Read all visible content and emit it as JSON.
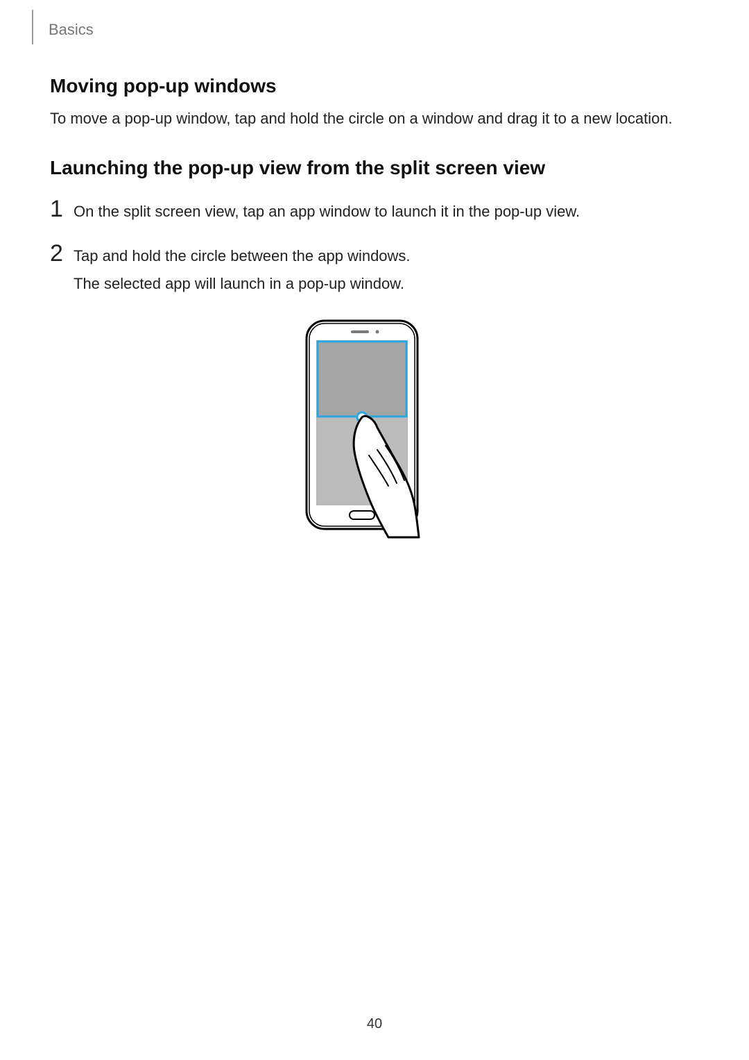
{
  "header": {
    "section": "Basics"
  },
  "sections": {
    "moving": {
      "title": "Moving pop-up windows",
      "body": "To move a pop-up window, tap and hold the circle on a window and drag it to a new location."
    },
    "launching": {
      "title": "Launching the pop-up view from the split screen view",
      "steps": [
        {
          "num": "1",
          "line1": "On the split screen view, tap an app window to launch it in the pop-up view."
        },
        {
          "num": "2",
          "line1": "Tap and hold the circle between the app windows.",
          "line2": "The selected app will launch in a pop-up window."
        }
      ]
    }
  },
  "pageNumber": "40"
}
